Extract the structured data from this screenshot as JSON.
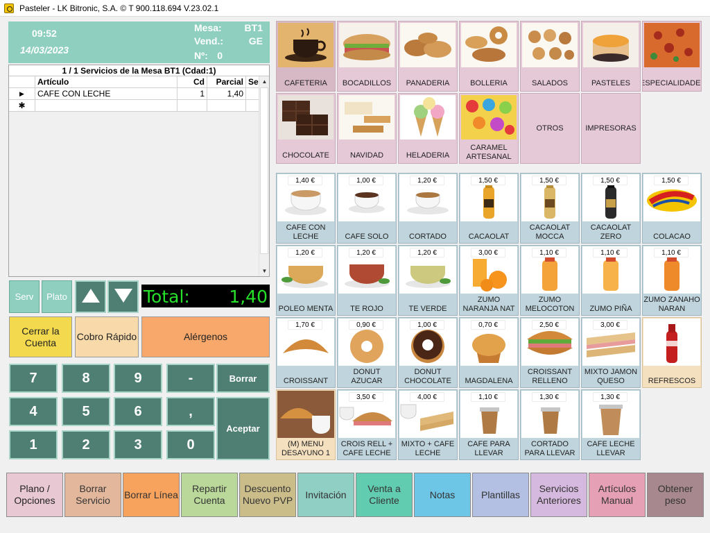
{
  "window": {
    "title": "Pasteler - LK Bitronic, S.A. ©  T 900.118.694 V.23.02.1"
  },
  "header": {
    "time": "09:52",
    "date": "14/03/2023",
    "mesa_label": "Mesa:",
    "mesa_value": "BT1",
    "vend_label": "Vend.:",
    "vend_value": "GE",
    "num_label": "Nº:",
    "num_value": "0"
  },
  "order": {
    "title": "1 / 1 Servicios de la Mesa BT1 (Cdad:1)",
    "columns": [
      "Artículo",
      "Cd",
      "Parcial",
      "Se"
    ],
    "rows": [
      {
        "marker": "▶",
        "articulo": "CAFE CON LECHE",
        "cd": "1",
        "parcial": "1,40",
        "se": ""
      }
    ],
    "new_marker": "✱"
  },
  "controls": {
    "serv": "Serv",
    "plato": "Plato",
    "total_label": "Total:",
    "total_value": "1,40",
    "cerrar": "Cerrar la Cuenta",
    "cobro": "Cobro Rápido",
    "alergenos": "Alérgenos"
  },
  "keypad": {
    "k7": "7",
    "k8": "8",
    "k9": "9",
    "kminus": "-",
    "borrar": "Borrar",
    "k4": "4",
    "k5": "5",
    "k6": "6",
    "kcomma": ",",
    "aceptar": "Aceptar",
    "k1": "1",
    "k2": "2",
    "k3": "3",
    "k0": "0"
  },
  "families": [
    {
      "label": "CAFETERIA",
      "icon": "coffee-cup-icon"
    },
    {
      "label": "BOCADILLOS",
      "icon": "sandwich-icon"
    },
    {
      "label": "PANADERIA",
      "icon": "bread-icon"
    },
    {
      "label": "BOLLERIA",
      "icon": "pastry-icon"
    },
    {
      "label": "SALADOS",
      "icon": "savory-icon"
    },
    {
      "label": "PASTELES",
      "icon": "cake-icon"
    },
    {
      "label": "ESPECIALIDADES",
      "icon": "pizza-icon"
    },
    {
      "label": "CHOCOLATE",
      "icon": "chocolate-icon"
    },
    {
      "label": "NAVIDAD",
      "icon": "nougat-icon"
    },
    {
      "label": "HELADERIA",
      "icon": "ice-cream-icon"
    },
    {
      "label": "CARAMEL ARTESANAL",
      "icon": "candy-icon"
    },
    {
      "label": "OTROS",
      "icon": ""
    },
    {
      "label": "IMPRESORAS",
      "icon": ""
    }
  ],
  "products": [
    {
      "price": "1,40 €",
      "label": "CAFE CON LECHE",
      "icon": "coffee-cup-icon"
    },
    {
      "price": "1,00 €",
      "label": "CAFE SOLO",
      "icon": "espresso-icon"
    },
    {
      "price": "1,20 €",
      "label": "CORTADO",
      "icon": "cortado-icon"
    },
    {
      "price": "1,50 €",
      "label": "CACAOLAT",
      "icon": "bottle-icon"
    },
    {
      "price": "1,50 €",
      "label": "CACAOLAT MOCCA",
      "icon": "bottle-icon"
    },
    {
      "price": "1,50 €",
      "label": "CACAOLAT ZERO",
      "icon": "bottle-icon"
    },
    {
      "price": "1,50 €",
      "label": "COLACAO",
      "icon": "colacao-logo-icon"
    },
    {
      "price": "1,20 €",
      "label": "POLEO MENTA",
      "icon": "tea-icon"
    },
    {
      "price": "1,20 €",
      "label": "TE ROJO",
      "icon": "tea-icon"
    },
    {
      "price": "1,20 €",
      "label": "TE VERDE",
      "icon": "tea-icon"
    },
    {
      "price": "3,00 €",
      "label": "ZUMO NARANJA NAT",
      "icon": "orange-juice-icon"
    },
    {
      "price": "1,10 €",
      "label": "ZUMO MELOCOTON",
      "icon": "juice-bottle-icon"
    },
    {
      "price": "1,10 €",
      "label": "ZUMO PIÑA",
      "icon": "juice-bottle-icon"
    },
    {
      "price": "1,10 €",
      "label": "ZUMO ZANAHO NARAN",
      "icon": "juice-bottle-icon"
    },
    {
      "price": "1,70 €",
      "label": "CROISSANT",
      "icon": "croissant-icon"
    },
    {
      "price": "0,90 €",
      "label": "DONUT AZUCAR",
      "icon": "donut-icon"
    },
    {
      "price": "1,00 €",
      "label": "DONUT CHOCOLATE",
      "icon": "chocolate-donut-icon"
    },
    {
      "price": "0,70 €",
      "label": "MAGDALENA",
      "icon": "muffin-icon"
    },
    {
      "price": "2,50 €",
      "label": "CROISSANT RELLENO",
      "icon": "filled-croissant-icon"
    },
    {
      "price": "3,00 €",
      "label": "MIXTO JAMON QUESO",
      "icon": "toast-icon"
    },
    {
      "price": "",
      "label": "REFRESCOS",
      "icon": "soda-bottle-icon"
    },
    {
      "price": "",
      "label": "(M) MENU DESAYUNO 1",
      "icon": "breakfast-icon"
    },
    {
      "price": "3,50 €",
      "label": "CROIS RELL + CAFE LECHE",
      "icon": "breakfast-icon"
    },
    {
      "price": "4,00 €",
      "label": "MIXTO + CAFE LECHE",
      "icon": "breakfast-icon"
    },
    {
      "price": "1,10 €",
      "label": "CAFE PARA LLEVAR",
      "icon": "takeaway-cup-icon"
    },
    {
      "price": "1,30 €",
      "label": "CORTADO PARA LLEVAR",
      "icon": "takeaway-cup-icon"
    },
    {
      "price": "1,30 €",
      "label": "CAFE LECHE LLEVAR",
      "icon": "takeaway-cup-icon"
    }
  ],
  "bottom": [
    {
      "label": "Plano / Opciones",
      "color": "#e8c8d2"
    },
    {
      "label": "Borrar Servicio",
      "color": "#e3b79c"
    },
    {
      "label": "Borrar Línea",
      "color": "#f7a35e"
    },
    {
      "label": "Repartir Cuenta",
      "color": "#b9d89a"
    },
    {
      "label": "Descuento Nuevo PVP",
      "color": "#cbbd8a"
    },
    {
      "label": "Invitación",
      "color": "#8fcfc4"
    },
    {
      "label": "Venta a Cliente",
      "color": "#62ccb0"
    },
    {
      "label": "Notas",
      "color": "#6ec6e6"
    },
    {
      "label": "Plantillas",
      "color": "#b3bfe3"
    },
    {
      "label": "Servicios Anteriores",
      "color": "#d6b9de"
    },
    {
      "label": "Artículos Manual",
      "color": "#e6a0b6"
    },
    {
      "label": "Obtener peso",
      "color": "#a7888f"
    }
  ]
}
